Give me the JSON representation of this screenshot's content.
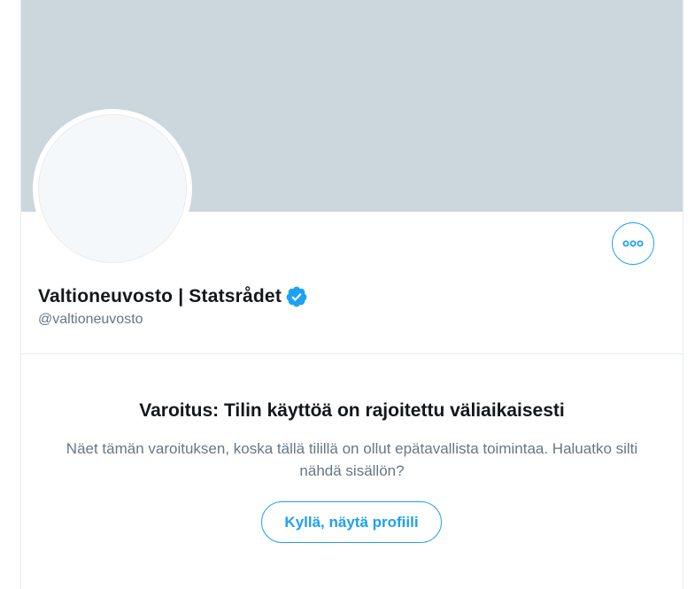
{
  "profile": {
    "display_name": "Valtioneuvosto | Statsrådet",
    "handle": "@valtioneuvosto",
    "verified": true,
    "more_icon": "more-horizontal-icon",
    "verified_icon": "verified-badge-icon"
  },
  "warning": {
    "title": "Varoitus: Tilin käyttöä on rajoitettu väliaikaisesti",
    "text": "Näet tämän varoituksen, koska tällä tilillä on ollut epätavallista toimintaa. Haluatko silti nähdä sisällön?",
    "button_label": "Kyllä, näytä profiili"
  },
  "colors": {
    "accent": "#1da1f2",
    "banner": "#ccd6dd",
    "text_primary": "#14171a",
    "text_secondary": "#657786",
    "border": "#e6ecf0"
  }
}
